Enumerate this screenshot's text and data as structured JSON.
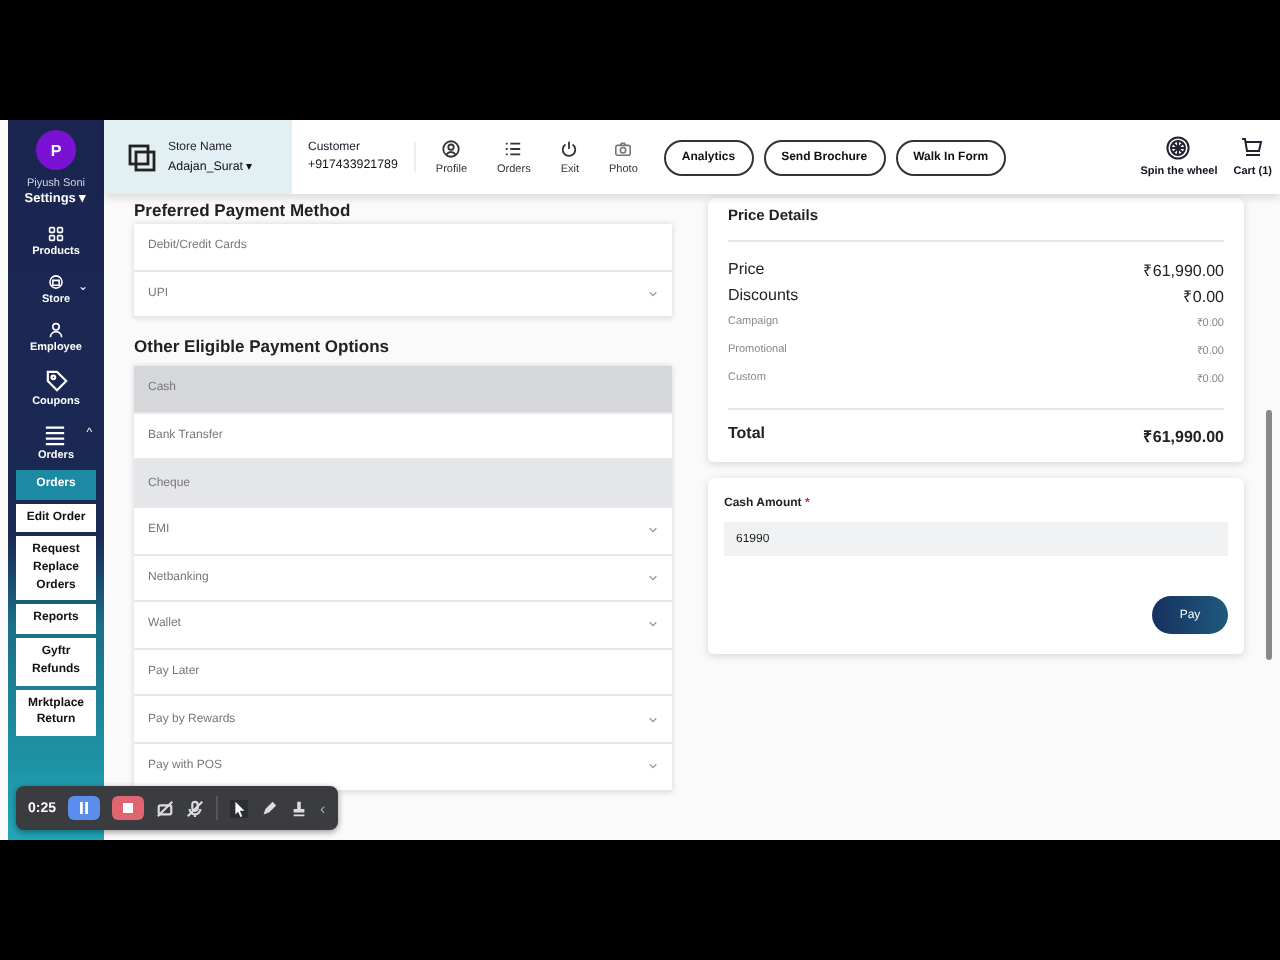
{
  "sidebar": {
    "avatar": "P",
    "user": "Piyush Soni",
    "settings": "Settings ▾",
    "items": [
      {
        "label": "Products"
      },
      {
        "label": "Store",
        "caret": "⌄"
      },
      {
        "label": "Employee"
      },
      {
        "label": "Coupons"
      },
      {
        "label": "Orders",
        "caret": "^"
      }
    ],
    "submenu": [
      {
        "label": "Orders",
        "selected": true
      },
      {
        "label": "Edit Order",
        "selected": false
      },
      {
        "label": "Request Replace Orders",
        "selected": false
      },
      {
        "label": "Reports",
        "selected": false
      },
      {
        "label": "Gyftr Refunds",
        "selected": false
      },
      {
        "label": "Mrktplace Return",
        "selected": false
      }
    ]
  },
  "header": {
    "store_label": "Store Name",
    "store_value": "Adajan_Surat ▾",
    "customer_label": "Customer",
    "customer_phone": "+917433921789",
    "actions": [
      {
        "label": "Profile"
      },
      {
        "label": "Orders"
      },
      {
        "label": "Exit"
      },
      {
        "label": "Photo"
      }
    ],
    "buttons": [
      "Analytics",
      "Send Brochure",
      "Walk In Form"
    ],
    "right": [
      {
        "label": "Spin the wheel"
      },
      {
        "label": "Cart (1)"
      }
    ]
  },
  "preferred": {
    "title": "Preferred Payment Method",
    "options": [
      {
        "label": "Debit/Credit Cards",
        "expandable": false
      },
      {
        "label": "UPI",
        "expandable": true
      }
    ]
  },
  "other": {
    "title": "Other Eligible Payment Options",
    "options": [
      {
        "label": "Cash",
        "selected": true,
        "hovered": false,
        "expandable": false
      },
      {
        "label": "Bank Transfer",
        "selected": false,
        "hovered": false,
        "expandable": false
      },
      {
        "label": "Cheque",
        "selected": false,
        "hovered": true,
        "expandable": false
      },
      {
        "label": "EMI",
        "selected": false,
        "hovered": false,
        "expandable": true
      },
      {
        "label": "Netbanking",
        "selected": false,
        "hovered": false,
        "expandable": true
      },
      {
        "label": "Wallet",
        "selected": false,
        "hovered": false,
        "expandable": true
      },
      {
        "label": "Pay Later",
        "selected": false,
        "hovered": false,
        "expandable": false
      },
      {
        "label": "Pay by Rewards",
        "selected": false,
        "hovered": false,
        "expandable": true
      },
      {
        "label": "Pay with POS",
        "selected": false,
        "hovered": false,
        "expandable": true
      }
    ]
  },
  "price": {
    "title": "Price Details",
    "rows": [
      {
        "label": "Price",
        "value": "₹61,990.00",
        "kind": "main"
      },
      {
        "label": "Discounts",
        "value": "₹0.00",
        "kind": "main"
      },
      {
        "label": "Campaign",
        "value": "₹0.00",
        "kind": "sub"
      },
      {
        "label": "Promotional",
        "value": "₹0.00",
        "kind": "sub"
      },
      {
        "label": "Custom",
        "value": "₹0.00",
        "kind": "sub"
      }
    ],
    "total_label": "Total",
    "total_value": "₹61,990.00"
  },
  "cash": {
    "label": "Cash Amount",
    "required": "*",
    "value": "61990",
    "button": "Pay"
  },
  "recorder": {
    "time": "0:25",
    "caret": "‹"
  }
}
